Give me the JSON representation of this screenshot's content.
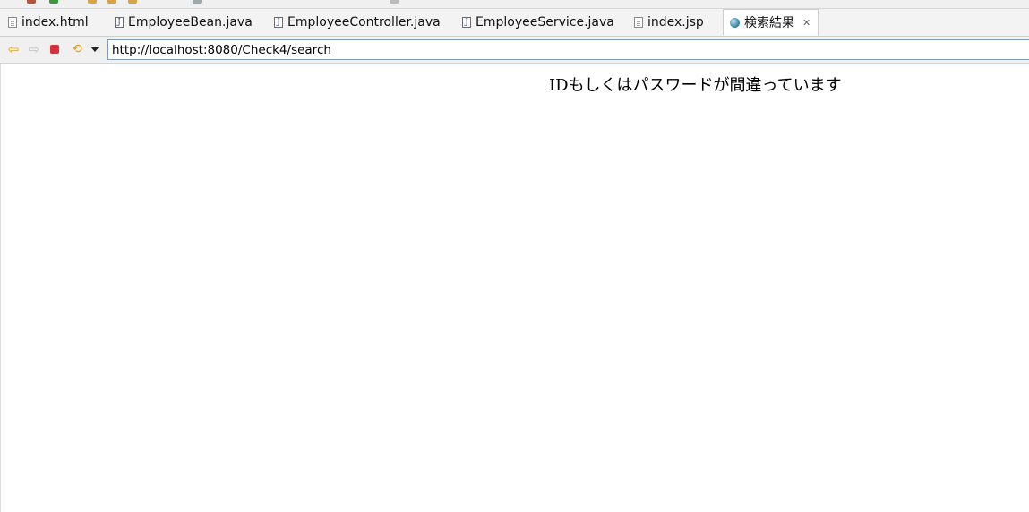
{
  "tabs": [
    {
      "label": "index.html",
      "icon": "html-file-icon"
    },
    {
      "label": "EmployeeBean.java",
      "icon": "java-file-icon"
    },
    {
      "label": "EmployeeController.java",
      "icon": "java-file-icon"
    },
    {
      "label": "EmployeeService.java",
      "icon": "java-file-icon"
    },
    {
      "label": "index.jsp",
      "icon": "jsp-file-icon"
    },
    {
      "label": "検索結果",
      "icon": "globe-icon",
      "active": true,
      "close": "✕"
    }
  ],
  "nav": {
    "back": "⇦",
    "forward": "⇨",
    "refresh": "⟲",
    "url": "http://localhost:8080/Check4/search"
  },
  "page": {
    "message": "IDもしくはパスワードが間違っています"
  },
  "colors": {
    "accent": "#e0a21a",
    "stop": "#d9303a",
    "url_border": "#7f9db9"
  }
}
